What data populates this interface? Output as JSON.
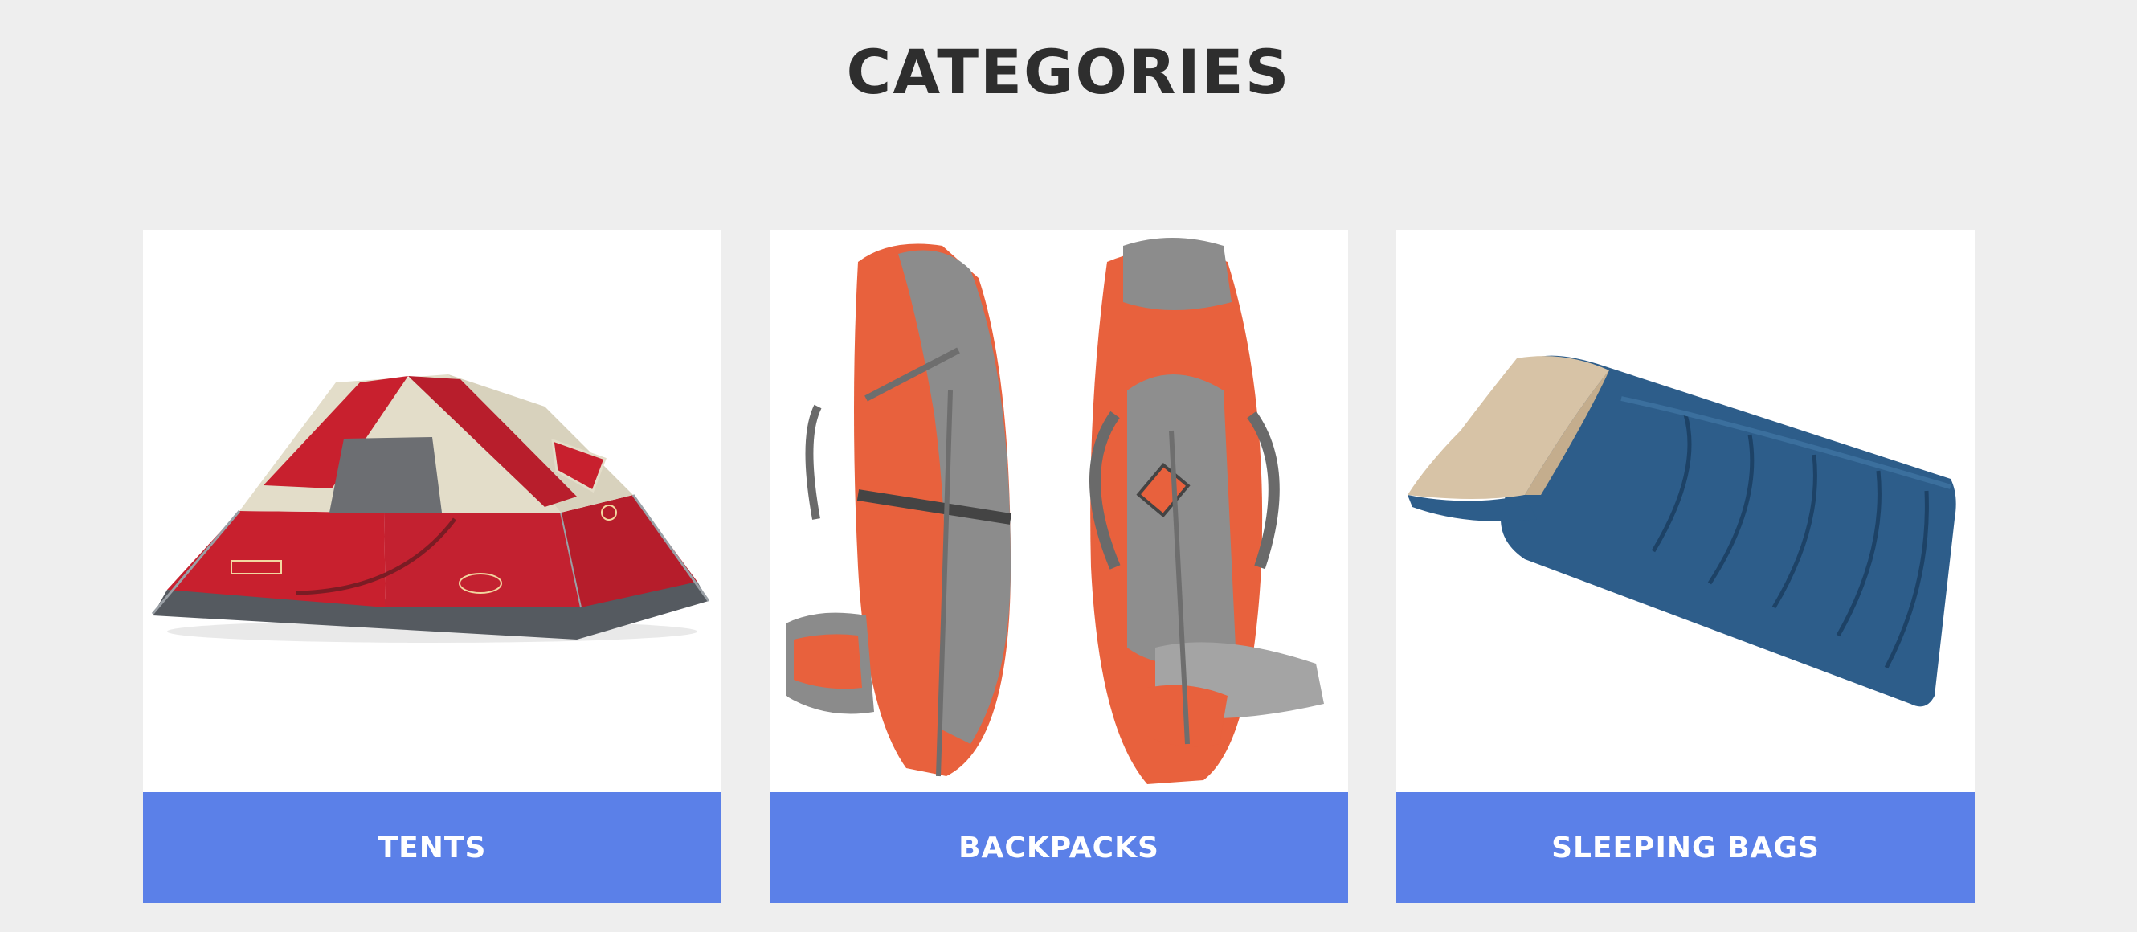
{
  "page": {
    "title": "CATEGORIES"
  },
  "theme": {
    "background": "#eeeeee",
    "accent": "#5b80e8",
    "title_color": "#2e2e2e"
  },
  "categories": [
    {
      "label": "TENTS",
      "image_icon": "tent-image"
    },
    {
      "label": "BACKPACKS",
      "image_icon": "backpack-image"
    },
    {
      "label": "SLEEPING BAGS",
      "image_icon": "sleeping-bag-image"
    }
  ]
}
